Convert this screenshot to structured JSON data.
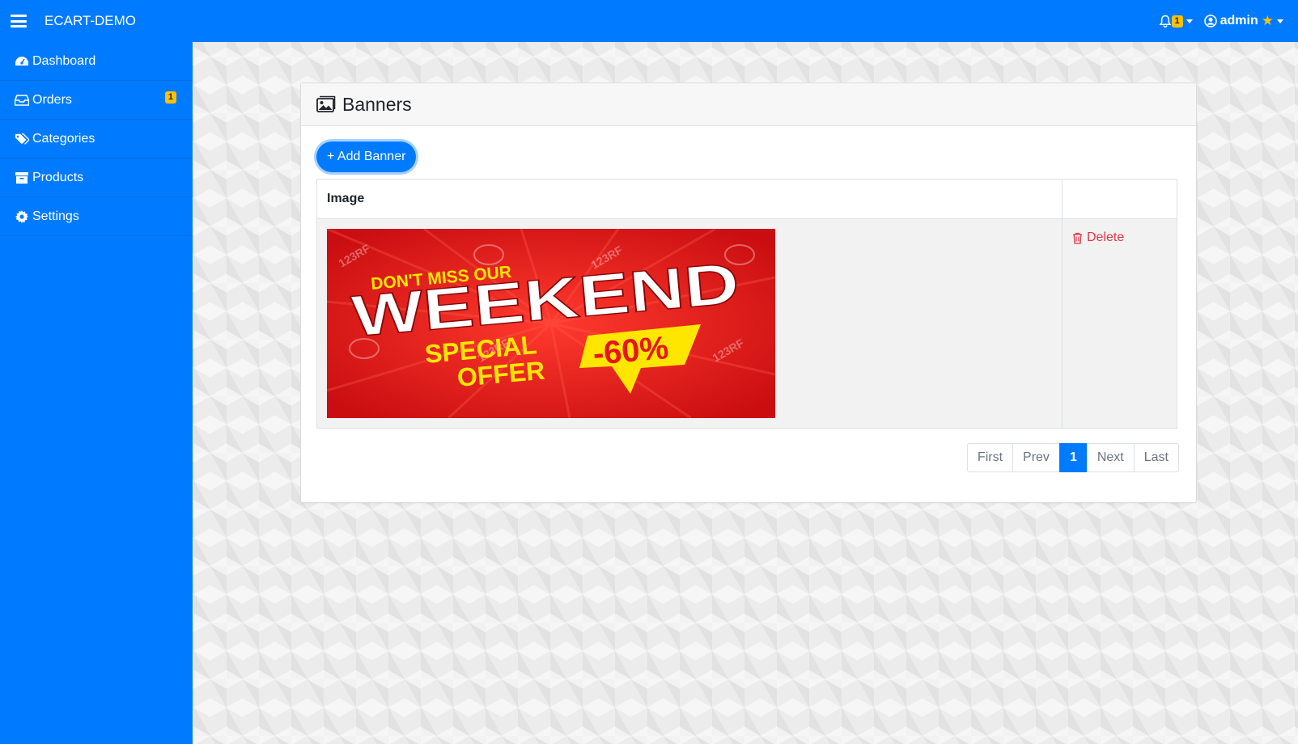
{
  "header": {
    "brand": "ECART-DEMO",
    "notification_count": "1",
    "user_name": "admin"
  },
  "sidebar": {
    "items": [
      {
        "label": "Dashboard",
        "icon": "dashboard-icon"
      },
      {
        "label": "Orders",
        "icon": "inbox-icon",
        "badge": "1"
      },
      {
        "label": "Categories",
        "icon": "tags-icon"
      },
      {
        "label": "Products",
        "icon": "archive-icon"
      },
      {
        "label": "Settings",
        "icon": "gear-icon"
      }
    ]
  },
  "page": {
    "title": "Banners",
    "add_button": "+ Add Banner",
    "table": {
      "columns": [
        "Image",
        ""
      ],
      "rows": [
        {
          "banner_text": {
            "line1": "DON'T MISS OUR",
            "line2": "WEEKEND",
            "line3": "SPECIAL",
            "line4": "OFFER",
            "discount": "-60%",
            "watermark": "123RF"
          },
          "action": "Delete"
        }
      ]
    },
    "pagination": [
      "First",
      "Prev",
      "1",
      "Next",
      "Last"
    ]
  },
  "colors": {
    "primary": "#007bff",
    "badge": "#ffc107",
    "danger": "#dc3545",
    "banner_red": "#e8141b",
    "banner_yellow": "#ffe600"
  }
}
